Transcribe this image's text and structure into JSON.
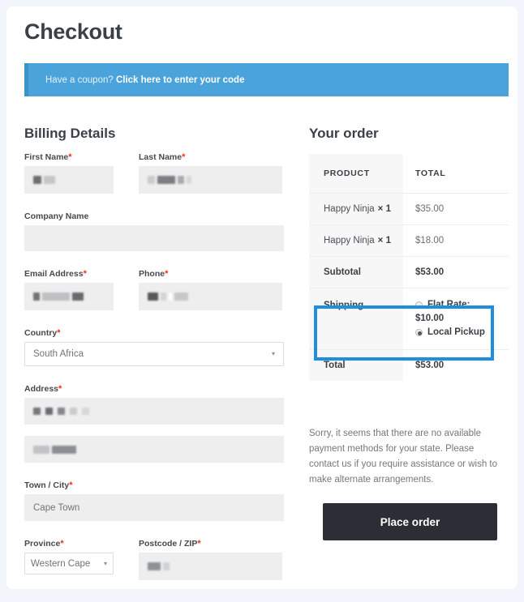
{
  "page": {
    "title": "Checkout",
    "background_color": "#f3f5fc",
    "card_color": "#ffffff"
  },
  "coupon": {
    "prompt": "Have a coupon?",
    "link_label": "Click here to enter your code",
    "bar_color": "#4aa3da",
    "border_color": "#3c93c9"
  },
  "billing": {
    "heading": "Billing Details",
    "fields": {
      "first_name": {
        "label": "First Name",
        "required": "*",
        "value": "",
        "redacted": true
      },
      "last_name": {
        "label": "Last Name",
        "required": "*",
        "value": "",
        "redacted": true
      },
      "company_name": {
        "label": "Company Name",
        "required": "",
        "value": ""
      },
      "email": {
        "label": "Email Address",
        "required": "*",
        "value": "",
        "redacted": true
      },
      "phone": {
        "label": "Phone",
        "required": "*",
        "value": "",
        "redacted": true
      },
      "country": {
        "label": "Country",
        "required": "*",
        "value": "South Africa",
        "caret": "▾"
      },
      "address_1": {
        "label": "Address",
        "required": "*",
        "value": "",
        "redacted": true
      },
      "address_2": {
        "label": "",
        "required": "",
        "value": "",
        "redacted": true
      },
      "city": {
        "label": "Town / City",
        "required": "*",
        "value": "Cape Town"
      },
      "province": {
        "label": "Province",
        "required": "*",
        "value": "Western Cape",
        "caret": "▾"
      },
      "postcode": {
        "label": "Postcode / ZIP",
        "required": "*",
        "value": "",
        "redacted": true
      }
    }
  },
  "order": {
    "heading": "Your order",
    "columns": {
      "product": "PRODUCT",
      "total": "TOTAL"
    },
    "items": [
      {
        "name": "Happy Ninja",
        "qty": "× 1",
        "total": "$35.00"
      },
      {
        "name": "Happy Ninja",
        "qty": "× 1",
        "total": "$18.00"
      }
    ],
    "subtotal": {
      "label": "Subtotal",
      "value": "$53.00"
    },
    "shipping": {
      "label": "Shipping",
      "highlight_color": "#1e8fe0",
      "options": [
        {
          "label": "Flat Rate:",
          "price": "$10.00",
          "selected": false
        },
        {
          "label": "Local Pickup",
          "price": "",
          "selected": true
        }
      ]
    },
    "total": {
      "label": "Total",
      "value": "$53.00"
    },
    "payment_notice": "Sorry, it seems that there are no available payment methods for your state. Please contact us if you require assistance or wish to make alternate arrangements.",
    "place_order_label": "Place order"
  }
}
